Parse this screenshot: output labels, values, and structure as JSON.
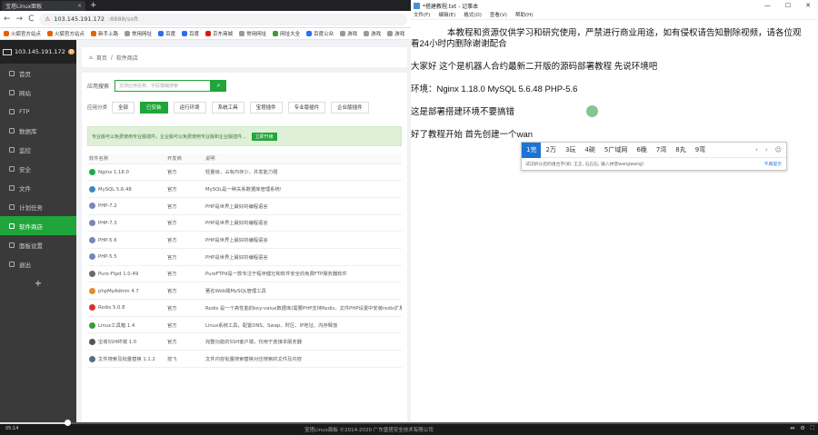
{
  "browser": {
    "tab_title": "宝塔Linux面板",
    "tab_close": "×",
    "new_tab": "+",
    "nav_back": "←",
    "nav_forward": "→",
    "nav_reload": "C",
    "security": "不安全",
    "url_host": "103.145.191.172",
    "url_path": ":8888/soft",
    "bookmarks": [
      "火狐官方站点",
      "火狐官方站点",
      "新手上路",
      "常用网址",
      "百度",
      "百度",
      "京东商城",
      "常用网址",
      "网址大全",
      "百度公众",
      "游戏",
      "游戏",
      "游戏"
    ]
  },
  "sidebar": {
    "ip": "103.145.191.172",
    "badge": "0",
    "items": [
      {
        "label": "首页",
        "active": false
      },
      {
        "label": "网站",
        "active": false
      },
      {
        "label": "FTP",
        "active": false
      },
      {
        "label": "数据库",
        "active": false
      },
      {
        "label": "监控",
        "active": false
      },
      {
        "label": "安全",
        "active": false
      },
      {
        "label": "文件",
        "active": false
      },
      {
        "label": "计划任务",
        "active": false
      },
      {
        "label": "软件商店",
        "active": true
      },
      {
        "label": "面板设置",
        "active": false
      },
      {
        "label": "退出",
        "active": false
      }
    ],
    "add": "+"
  },
  "main": {
    "crumb_home": "首页",
    "crumb_sep": "/",
    "crumb_current": "软件商店",
    "search_label": "应用搜索",
    "search_placeholder": "支持应用名称、字段模糊搜索",
    "category_label": "应用分类",
    "categories": [
      {
        "label": "全部",
        "active": false
      },
      {
        "label": "已安装",
        "active": true
      },
      {
        "label": "运行环境",
        "active": false
      },
      {
        "label": "系统工具",
        "active": false
      },
      {
        "label": "宝塔插件",
        "active": false
      },
      {
        "label": "专业版插件",
        "active": false
      },
      {
        "label": "企业版插件",
        "active": false
      }
    ],
    "notice": "专业版可以免费使用专业版插件，企业版可以免费使用专业版和企业版插件...",
    "notice_button": "立即升级",
    "table": {
      "headers": [
        "软件名称",
        "开发商",
        "说明"
      ],
      "rows": [
        {
          "name": "Nginx 1.18.0",
          "dev": "官方",
          "desc": "轻量级，占有内存少，并发能力强",
          "color": "#1ea94a"
        },
        {
          "name": "MySQL 5.6.48",
          "dev": "官方",
          "desc": "MySQL是一种关系数据库管理系统!",
          "color": "#3c88c6"
        },
        {
          "name": "PHP-7.2",
          "dev": "官方",
          "desc": "PHP是世界上最好的编程语言",
          "color": "#7a86b8"
        },
        {
          "name": "PHP-7.3",
          "dev": "官方",
          "desc": "PHP是世界上最好的编程语言",
          "color": "#7a86b8"
        },
        {
          "name": "PHP-5.6",
          "dev": "官方",
          "desc": "PHP是世界上最好的编程语言",
          "color": "#7a86b8"
        },
        {
          "name": "PHP-5.5",
          "dev": "官方",
          "desc": "PHP是世界上最好的编程语言",
          "color": "#7a86b8"
        },
        {
          "name": "Pure-Ftpd 1.0.49",
          "dev": "官方",
          "desc": "PureFTPd是一款专注于程序健壮和软件安全的免费FTP服务器软件",
          "color": "#6a6a6a"
        },
        {
          "name": "phpMyAdmin 4.7",
          "dev": "官方",
          "desc": "著名Web端MySQL管理工具",
          "color": "#e88a2d"
        },
        {
          "name": "Redis 5.0.8",
          "dev": "官方",
          "desc": "Redis 是一个高性能的key-value数据库(需要PHP支持Redis，文件PHP设置中安装redis扩展)",
          "color": "#d8342c"
        },
        {
          "name": "Linux工具箱 1.4",
          "dev": "官方",
          "desc": "Linux系统工具，配置DNS、Swap、时区、IP地址、内存释放",
          "color": "#3a9b3a"
        },
        {
          "name": "宝塔SSH终端 1.0",
          "dev": "官方",
          "desc": "完整功能的SSH客户端，仅用于连接本服务器",
          "color": "#555555"
        },
        {
          "name": "文件搜索及批量替换 1.1.2",
          "dev": "技飞",
          "desc": "文件内容批量搜索替换对应搜索的文件及内容",
          "color": "#5a6b7c"
        }
      ]
    }
  },
  "notepad": {
    "title": "*搭建教程.txt - 记事本",
    "controls": [
      "—",
      "☐",
      "✕"
    ],
    "menu": [
      "文件(F)",
      "编辑(E)",
      "格式(O)",
      "查看(V)",
      "帮助(H)"
    ],
    "line1": "本教程和资源仅供学习和研究使用，严禁进行商业用途，如有侵权请告知删除视频，请各位观",
    "line2": "看24小时内删除谢谢配合",
    "line3": "大家好 这个是机器人合约最新二开版的源码部署教程 先说环境吧",
    "line4": "环境：Nginx 1.18.0  MySQL 5.6.48  PHP-5.6",
    "line5": "这是部署搭建环境不要搞错",
    "line6": "好了教程开始 首先创建一个wan"
  },
  "ime": {
    "candidates": [
      {
        "label": "1完",
        "selected": true
      },
      {
        "label": "2万",
        "selected": false
      },
      {
        "label": "3玩",
        "selected": false
      },
      {
        "label": "4碗",
        "selected": false
      },
      {
        "label": "5广域网",
        "selected": false
      },
      {
        "label": "6晚",
        "selected": false
      },
      {
        "label": "7湾",
        "selected": false
      },
      {
        "label": "8丸",
        "selected": false
      },
      {
        "label": "9弯",
        "selected": false
      }
    ],
    "arrow_prev": "‹",
    "arrow_next": "›",
    "emoji": "☺",
    "hint": "试试拆分后的组合字(如: 王王, 石石石, 输入拼音wangwang)",
    "hide": "不再提示"
  },
  "player": {
    "time": "05:14",
    "progress_fraction": 0.082,
    "footer": "宝塔Linux面板 ©2014-2020 广东堡塔安全技术有限公司",
    "controls": [
      "⏯",
      "⚙",
      "⛶"
    ]
  },
  "colors": {
    "accent": "#20a53a",
    "sidebar_bg": "#3a3a3a",
    "ime_selected": "#1e73d1"
  }
}
